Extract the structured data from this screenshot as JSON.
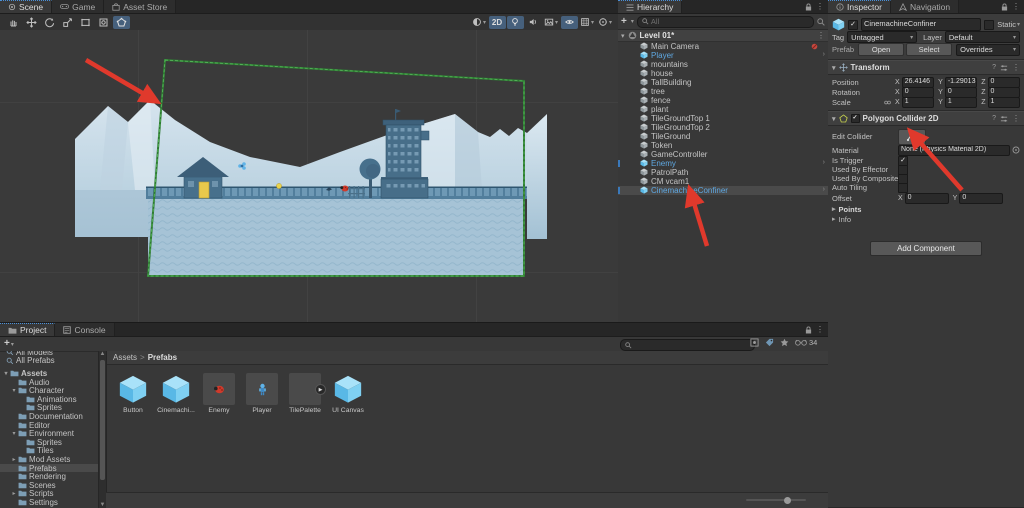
{
  "colors": {
    "accent_blue": "#46607c",
    "selection_mark": "#3a79bb",
    "prefab_text": "#5fa8e2",
    "green_outline": "#3f9143",
    "arrow_red": "#e0392c"
  },
  "scene": {
    "tabs": [
      {
        "label": "Scene"
      },
      {
        "label": "Game"
      },
      {
        "label": "Asset Store"
      }
    ],
    "toolbar": {
      "mode_2d": "2D"
    }
  },
  "hierarchy": {
    "title": "Hierarchy",
    "add_button": "+",
    "search_placeholder": "All",
    "scene_row": "Level 01*",
    "items": [
      {
        "label": "Main Camera",
        "icon": "gameobject",
        "badge": "camera-overlay"
      },
      {
        "label": "Player",
        "icon": "prefab",
        "chevron": true
      },
      {
        "label": "mountains",
        "icon": "gameobject"
      },
      {
        "label": "house",
        "icon": "gameobject"
      },
      {
        "label": "TallBuilding",
        "icon": "gameobject"
      },
      {
        "label": "tree",
        "icon": "gameobject"
      },
      {
        "label": "fence",
        "icon": "gameobject"
      },
      {
        "label": "plant",
        "icon": "gameobject"
      },
      {
        "label": "TileGroundTop 1",
        "icon": "gameobject"
      },
      {
        "label": "TileGroundTop 2",
        "icon": "gameobject"
      },
      {
        "label": "TileGround",
        "icon": "gameobject"
      },
      {
        "label": "Token",
        "icon": "gameobject"
      },
      {
        "label": "GameController",
        "icon": "gameobject"
      },
      {
        "label": "Enemy",
        "icon": "prefab",
        "chevron": true,
        "edge_mark": true
      },
      {
        "label": "PatrolPath",
        "icon": "gameobject"
      },
      {
        "label": "CM vcam1",
        "icon": "gameobject"
      },
      {
        "label": "CinemachineConfiner",
        "icon": "prefab",
        "chevron": true,
        "edge_mark": true,
        "selected": true
      }
    ]
  },
  "inspector": {
    "tabs": [
      {
        "label": "Inspector"
      },
      {
        "label": "Navigation"
      }
    ],
    "header": {
      "name": "CinemachineConfiner",
      "static_label": "Static",
      "tag_label": "Tag",
      "tag_value": "Untagged",
      "layer_label": "Layer",
      "layer_value": "Default",
      "prefab_label": "Prefab",
      "open_button": "Open",
      "select_button": "Select",
      "overrides_button": "Overrides"
    },
    "transform": {
      "title": "Transform",
      "axis_labels": [
        "X",
        "Y",
        "Z"
      ],
      "rows": [
        {
          "label": "Position",
          "values": [
            "26.4146",
            "-1.29013",
            "0"
          ]
        },
        {
          "label": "Rotation",
          "values": [
            "0",
            "0",
            "0"
          ]
        },
        {
          "label": "Scale",
          "values": [
            "1",
            "1",
            "1"
          ],
          "linked": true
        }
      ]
    },
    "polygon_collider": {
      "title": "Polygon Collider 2D",
      "edit_collider_label": "Edit Collider",
      "material_label": "Material",
      "material_value": "None (Physics Material 2D)",
      "toggles": [
        {
          "label": "Is Trigger",
          "checked": true
        },
        {
          "label": "Used By Effector",
          "checked": false
        },
        {
          "label": "Used By Composite",
          "checked": false
        },
        {
          "label": "Auto Tiling",
          "checked": false
        }
      ],
      "offset": {
        "label": "Offset",
        "x_label": "X",
        "x": "0",
        "y_label": "Y",
        "y": "0"
      },
      "foldouts": [
        "Points",
        "Info"
      ]
    },
    "add_component_button": "Add Component"
  },
  "project": {
    "tabs": [
      {
        "label": "Project"
      },
      {
        "label": "Console"
      }
    ],
    "add_button": "+",
    "favorites": [
      {
        "label": "All Models"
      },
      {
        "label": "All Prefabs"
      }
    ],
    "tree": [
      {
        "label": "Assets",
        "depth": 0,
        "state": "open",
        "bold": true
      },
      {
        "label": "Audio",
        "depth": 1,
        "state": "none"
      },
      {
        "label": "Character",
        "depth": 1,
        "state": "open"
      },
      {
        "label": "Animations",
        "depth": 2,
        "state": "none"
      },
      {
        "label": "Sprites",
        "depth": 2,
        "state": "none"
      },
      {
        "label": "Documentation",
        "depth": 1,
        "state": "none"
      },
      {
        "label": "Editor",
        "depth": 1,
        "state": "none"
      },
      {
        "label": "Environment",
        "depth": 1,
        "state": "open"
      },
      {
        "label": "Sprites",
        "depth": 2,
        "state": "none"
      },
      {
        "label": "Tiles",
        "depth": 2,
        "state": "none"
      },
      {
        "label": "Mod Assets",
        "depth": 1,
        "state": "collapsed"
      },
      {
        "label": "Prefabs",
        "depth": 1,
        "state": "none",
        "selected": true
      },
      {
        "label": "Rendering",
        "depth": 1,
        "state": "none"
      },
      {
        "label": "Scenes",
        "depth": 1,
        "state": "none"
      },
      {
        "label": "Scripts",
        "depth": 1,
        "state": "collapsed"
      },
      {
        "label": "Settings",
        "depth": 1,
        "state": "none"
      }
    ],
    "breadcrumb": {
      "root": "Assets",
      "separator": ">",
      "current": "Prefabs"
    },
    "assets": [
      {
        "label": "Button",
        "thumb": "prefab-cube"
      },
      {
        "label": "Cinemachi...",
        "thumb": "prefab-cube"
      },
      {
        "label": "Enemy",
        "thumb": "enemy-sprite"
      },
      {
        "label": "Player",
        "thumb": "player-sprite"
      },
      {
        "label": "TilePalette",
        "thumb": "tile-palette",
        "expand_badge": true
      },
      {
        "label": "UI Canvas",
        "thumb": "prefab-cube"
      }
    ],
    "hidden_count": "34"
  }
}
